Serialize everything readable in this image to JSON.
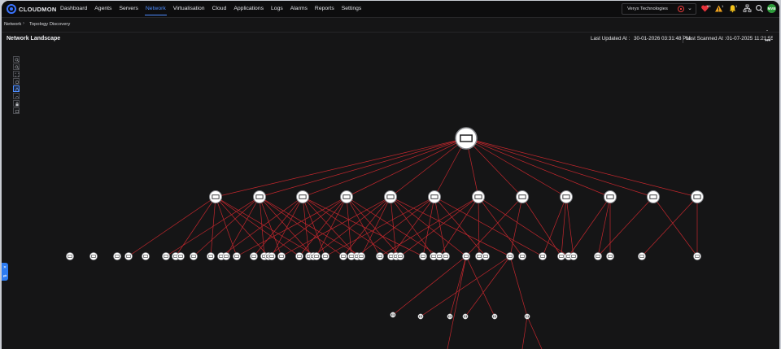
{
  "app": {
    "brand": "CLOUDMON"
  },
  "nav": {
    "items": [
      {
        "label": "Dashboard"
      },
      {
        "label": "Agents"
      },
      {
        "label": "Servers"
      },
      {
        "label": "Network",
        "active": true
      },
      {
        "label": "Virtualisation"
      },
      {
        "label": "Cloud"
      },
      {
        "label": "Applications"
      },
      {
        "label": "Logs"
      },
      {
        "label": "Alarms"
      },
      {
        "label": "Reports"
      },
      {
        "label": "Settings"
      }
    ],
    "tenant": "Veryx Technologies",
    "avatar_initials": "MVB",
    "notification_counts": {
      "alarms_critical": "99",
      "alarms_warning": "1",
      "alerts": "1"
    }
  },
  "breadcrumb": {
    "parent": "Network",
    "current": "Topology Discovery"
  },
  "page": {
    "title": "Network Landscape",
    "last_updated_label": "Last Updated At :",
    "last_updated_value": "30-01-2026 03:31:48 PM",
    "last_scanned_label": "Last Scanned At :",
    "last_scanned_value": "01-07-2025 11:21:55 AM"
  },
  "toolbar": {
    "tools": [
      "zoom-in-icon",
      "zoom-out-icon",
      "fit-screen-icon",
      "reset-icon",
      "tree-layout-icon",
      "radial-layout-icon",
      "lock-icon",
      "export-icon"
    ],
    "active_tool": "tree-layout-icon"
  },
  "colors": {
    "accent": "#4d8dff",
    "link": "#c2272d",
    "node_fill": "#ffffff",
    "background": "#151516"
  },
  "topology": {
    "root": {
      "type": "switch"
    },
    "level1_count": 12,
    "level2_count": 46,
    "level3_count": 8
  }
}
